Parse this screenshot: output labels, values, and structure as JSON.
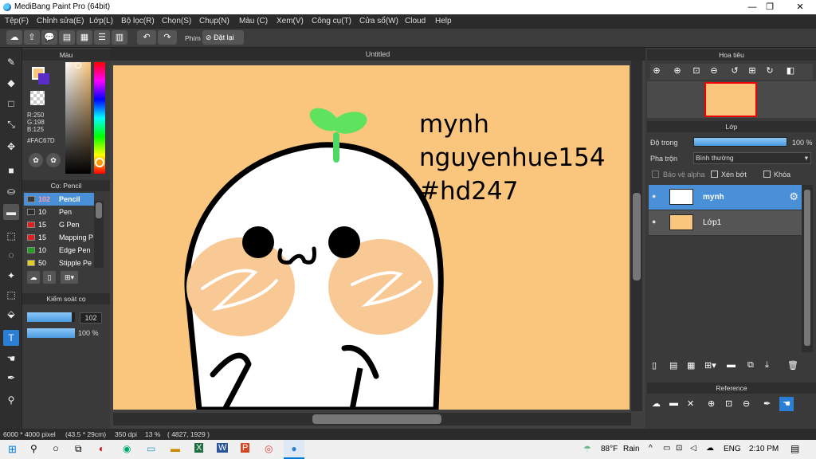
{
  "window": {
    "title": "MediBang Paint Pro (64bit)",
    "minimize": "—",
    "maximize": "❐",
    "close": "✕"
  },
  "menu": [
    "Tệp(F)",
    "Chỉnh sửa(E)",
    "Lớp(L)",
    "Bộ lọc(R)",
    "Chọn(S)",
    "Chụp(N)",
    "Màu (C)",
    "Xem(V)",
    "Công cụ(T)",
    "Cửa sổ(W)",
    "Cloud",
    "Help"
  ],
  "toolbar": {
    "phim_label": "Phím",
    "reset_label": "Đặt lại"
  },
  "color_panel": {
    "title": "Màu",
    "r": "R:250",
    "g": "G:198",
    "b": "B:125",
    "hex": "#FAC67D",
    "primary": "#FAC67D",
    "secondary": "#5a2dc8"
  },
  "brush_panel": {
    "title": "Cọ: Pencil",
    "items": [
      {
        "size": "102",
        "name": "Pencil",
        "color": "#3a3a3a"
      },
      {
        "size": "10",
        "name": "Pen",
        "color": "#2a2a2a"
      },
      {
        "size": "15",
        "name": "G Pen",
        "color": "#e02020"
      },
      {
        "size": "15",
        "name": "Mapping P",
        "color": "#e02020"
      },
      {
        "size": "10",
        "name": "Edge Pen",
        "color": "#20a020"
      },
      {
        "size": "50",
        "name": "Stipple Pe",
        "color": "#e0d020"
      }
    ]
  },
  "brush_control": {
    "title": "Kiểm soát cọ",
    "size_value": "102",
    "opacity_value": "100 %",
    "size_fraction": 0.93,
    "opacity_fraction": 1.0
  },
  "canvas": {
    "tab_title": "Untitled",
    "bg_color": "#FAC67D",
    "text_line1": "mynh",
    "text_line2": "nguyenhue154",
    "text_line3": "#hd247"
  },
  "navigator": {
    "title": "Hoa tiêu"
  },
  "layer_panel": {
    "title": "Lớp",
    "opacity_label": "Độ trong",
    "opacity_value": "100 %",
    "blend_label": "Pha trộn",
    "blend_value": "Bình thường",
    "protect_alpha": "Bảo vệ alpha",
    "clipping": "Xén bớt",
    "lock": "Khóa",
    "layers": [
      {
        "name": "mynh",
        "selected": true
      },
      {
        "name": "Lớp1",
        "selected": false
      }
    ]
  },
  "reference_panel": {
    "title": "Reference"
  },
  "status": {
    "size": "6000 * 4000 pixel",
    "cm": "(43.5 * 29cm)",
    "dpi": "350 dpi",
    "zoom": "13 %",
    "coords": "( 4827, 1929 )"
  },
  "taskbar": {
    "weather_temp": "88°F",
    "weather_text": "Rain",
    "lang": "ENG",
    "time": "2:10 PM"
  }
}
